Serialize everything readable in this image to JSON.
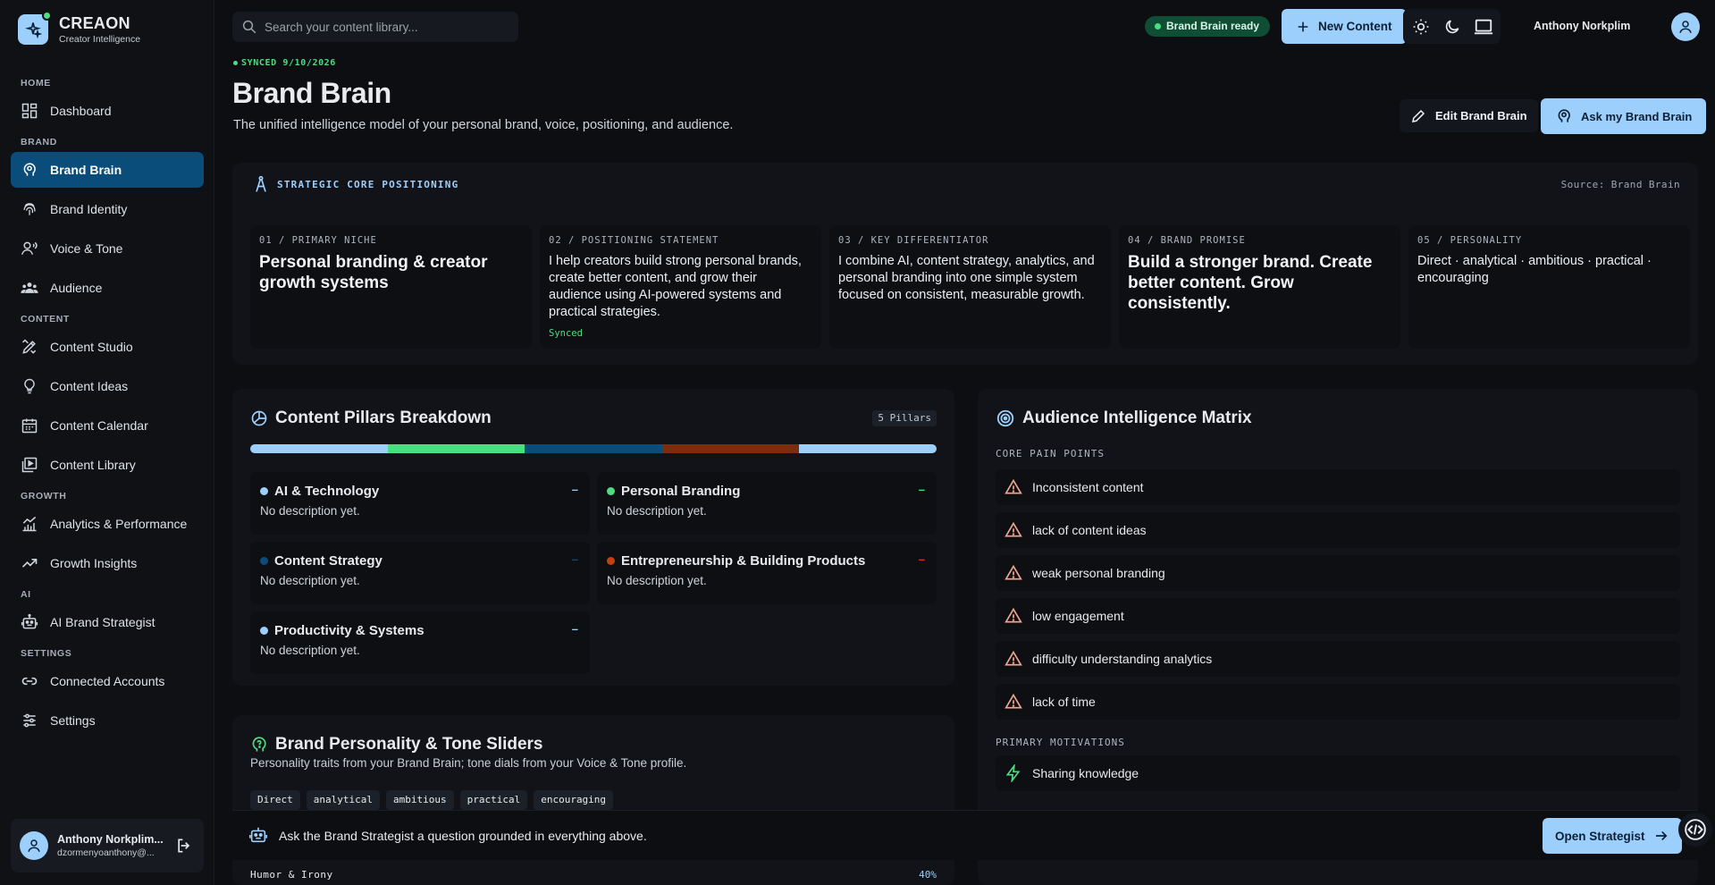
{
  "app": {
    "name": "CREAON",
    "tagline": "Creator Intelligence"
  },
  "search": {
    "placeholder": "Search your content library..."
  },
  "topbar": {
    "status_badge": "Brand Brain ready",
    "new_content_label": "New Content",
    "user_name": "Anthony Norkplim Dzo..."
  },
  "sidebar": {
    "sections": {
      "home": "HOME",
      "brand": "BRAND",
      "content": "CONTENT",
      "growth": "GROWTH",
      "ai": "AI",
      "settings": "SETTINGS"
    },
    "items": {
      "dashboard": "Dashboard",
      "brand_brain": "Brand Brain",
      "brand_identity": "Brand Identity",
      "voice_tone": "Voice & Tone",
      "audience": "Audience",
      "content_studio": "Content Studio",
      "content_ideas": "Content Ideas",
      "content_calendar": "Content Calendar",
      "content_library": "Content Library",
      "analytics": "Analytics & Performance",
      "growth_insights": "Growth Insights",
      "ai_strategist": "AI Brand Strategist",
      "connected_accounts": "Connected Accounts",
      "settings": "Settings"
    },
    "user": {
      "name": "Anthony Norkplim...",
      "email": "dzormenyoanthony@..."
    }
  },
  "header": {
    "synced": "SYNCED 9/10/2026",
    "title": "Brand Brain",
    "subtitle": "The unified intelligence model of your personal brand, voice, positioning, and audience.",
    "edit_label": "Edit Brand Brain",
    "ask_label": "Ask my Brand Brain"
  },
  "positioning": {
    "title": "STRATEGIC CORE POSITIONING",
    "source": "Source: Brand Brain",
    "cards": [
      {
        "label": "01 / PRIMARY NICHE",
        "value": "Personal branding & creator growth systems"
      },
      {
        "label": "02 / POSITIONING STATEMENT",
        "value": "I help creators build strong personal brands, create better content, and grow their audience using AI-powered systems and practical strategies.",
        "status": "Synced"
      },
      {
        "label": "03 / KEY DIFFERENTIATOR",
        "value": "I combine AI, content strategy, analytics, and personal branding into one simple system focused on consistent, measurable growth."
      },
      {
        "label": "04 / BRAND PROMISE",
        "value": "Build a stronger brand. Create better content. Grow consistently."
      },
      {
        "label": "05 / PERSONALITY",
        "value": "Direct · analytical · ambitious · practical · encouraging"
      }
    ]
  },
  "pillars": {
    "title": "Content Pillars Breakdown",
    "count": "5 Pillars",
    "colors": [
      "#9ccffb",
      "#4ade80",
      "#0b4d7a",
      "#7c2d0b",
      "#9ccffb"
    ],
    "items": [
      {
        "name": "AI & Technology",
        "desc": "No description yet.",
        "dash": "–",
        "color": "#9ccffb"
      },
      {
        "name": "Personal Branding",
        "desc": "No description yet.",
        "dash": "–",
        "color": "#4ade80"
      },
      {
        "name": "Content Strategy",
        "desc": "No description yet.",
        "dash": "–",
        "color": "#0b4d7a"
      },
      {
        "name": "Entrepreneurship & Building Products",
        "desc": "No description yet.",
        "dash": "–",
        "color": "#c2410c"
      },
      {
        "name": "Productivity & Systems",
        "desc": "No description yet.",
        "dash": "–",
        "color": "#9ccffb"
      }
    ]
  },
  "tone": {
    "title": "Brand Personality & Tone Sliders",
    "subtitle": "Personality traits from your Brand Brain; tone dials from your Voice & Tone profile.",
    "chips": [
      "Direct",
      "analytical",
      "ambitious",
      "practical",
      "encouraging"
    ],
    "humor_label": "Humor & Irony",
    "humor_value": "40%"
  },
  "audience": {
    "title": "Audience Intelligence Matrix",
    "pain_label": "CORE PAIN POINTS",
    "pain_points": [
      "Inconsistent content",
      "lack of content ideas",
      "weak personal branding",
      "low engagement",
      "difficulty understanding analytics",
      "lack of time"
    ],
    "motivation_label": "PRIMARY MOTIVATIONS",
    "motivations": [
      "Sharing knowledge"
    ]
  },
  "strategist": {
    "prompt": "Ask the Brand Strategist a question grounded in everything above.",
    "open_label": "Open Strategist"
  }
}
